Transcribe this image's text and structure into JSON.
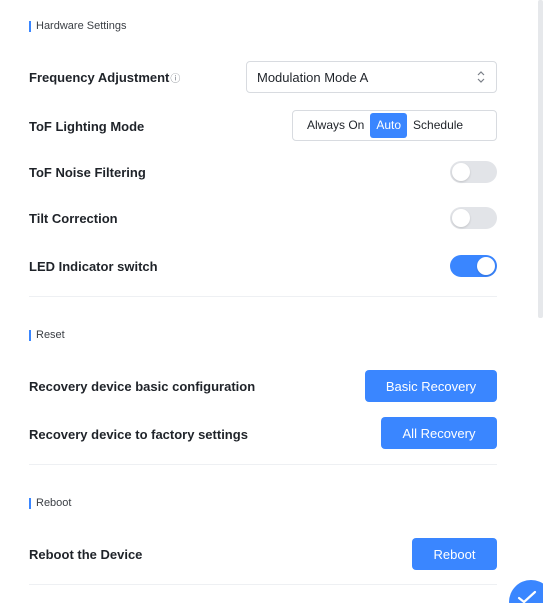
{
  "hardware": {
    "title": "Hardware Settings",
    "frequency": {
      "label": "Frequency Adjustment",
      "info_icon": "ⓘ",
      "value": "Modulation Mode A"
    },
    "lighting": {
      "label": "ToF Lighting Mode",
      "options": [
        "Always On",
        "Auto",
        "Schedule"
      ],
      "selected": "Auto"
    },
    "noise": {
      "label": "ToF Noise Filtering",
      "on": false
    },
    "tilt": {
      "label": "Tilt Correction",
      "on": false
    },
    "led": {
      "label": "LED Indicator switch",
      "on": true
    }
  },
  "reset": {
    "title": "Reset",
    "basic": {
      "label": "Recovery device basic configuration",
      "button": "Basic Recovery"
    },
    "factory": {
      "label": "Recovery device to factory settings",
      "button": "All Recovery"
    }
  },
  "reboot": {
    "title": "Reboot",
    "device": {
      "label": "Reboot the Device",
      "button": "Reboot"
    }
  },
  "accent_color": "#3a86ff",
  "icons": {
    "select_chevron": "up-down-chevron-icon",
    "fab": "checkmark-icon"
  }
}
